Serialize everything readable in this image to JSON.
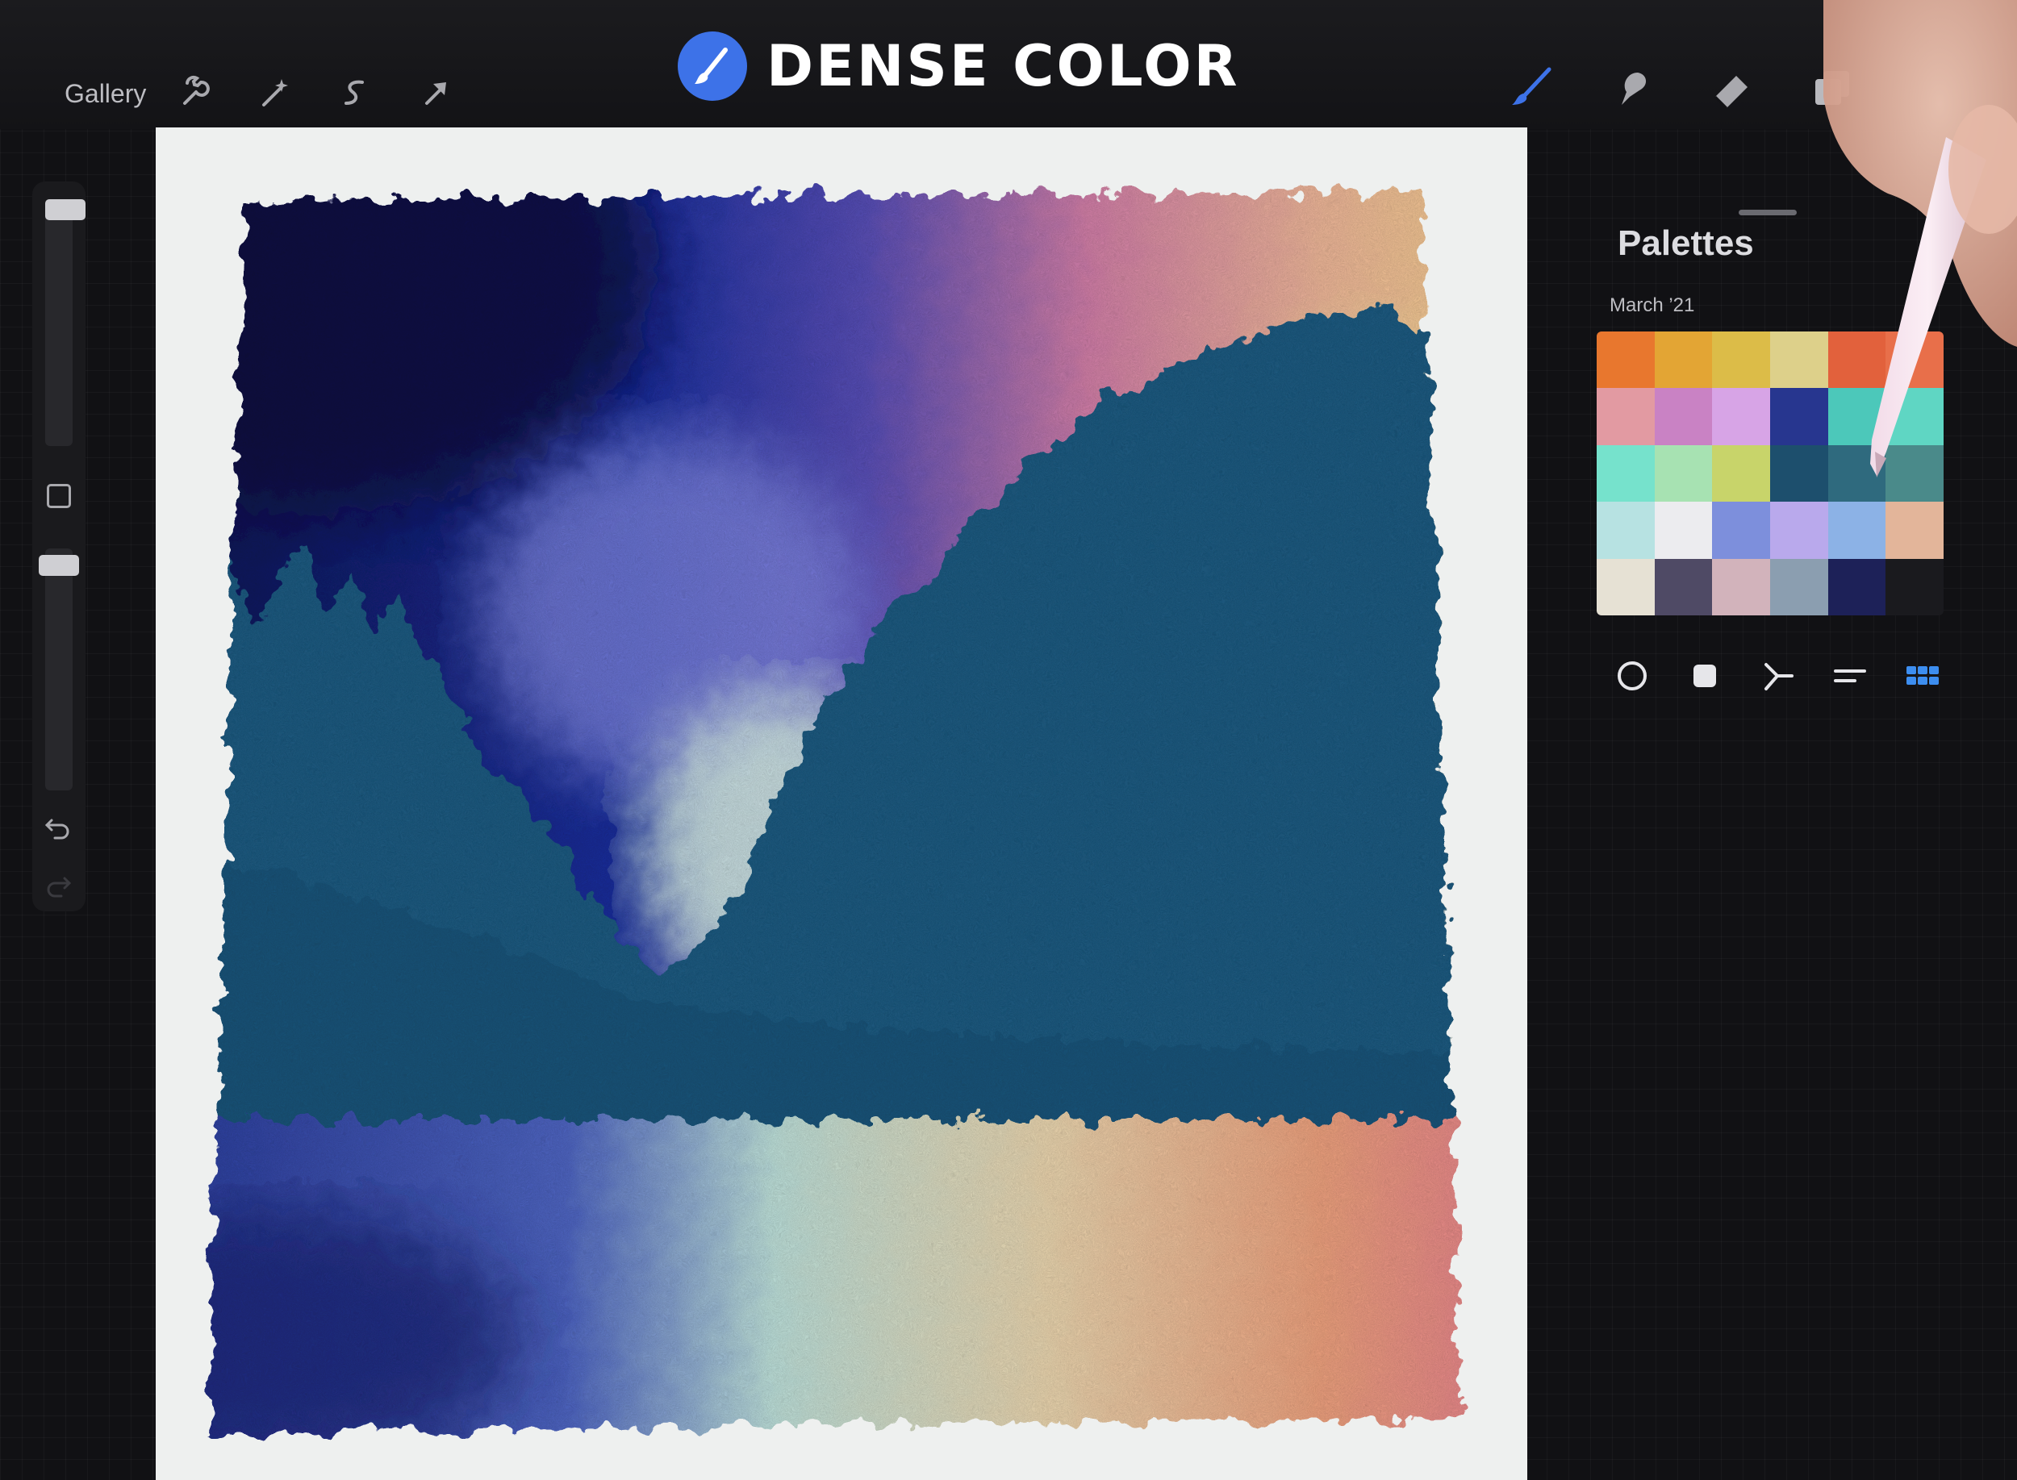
{
  "toolbar": {
    "gallery_label": "Gallery",
    "title": "DENSE COLOR",
    "left_icons": [
      "wrench-icon",
      "magic-wand-icon",
      "selection-icon",
      "move-arrow-icon"
    ],
    "right_icons": [
      "brush-icon",
      "smudge-icon",
      "eraser-icon",
      "layers-icon"
    ],
    "accent_color": "#3d72e8"
  },
  "palette_panel": {
    "title": "Palettes",
    "palette_name": "March ’21",
    "swatches": [
      "#e8772e",
      "#e3a534",
      "#dcbc48",
      "#ddd08a",
      "#e2613c",
      "#e86f4a",
      "#e29aa2",
      "#c982c4",
      "#d7a4e6",
      "#27368f",
      "#4cc8ba",
      "#5fd6c3",
      "#76e2cc",
      "#a7e2b2",
      "#c8d46a",
      "#1d4f6d",
      "#2f6a7e",
      "#4a8a8a",
      "#b7e2e2",
      "#ececef",
      "#7d8fdc",
      "#b9a9ec",
      "#8cb2e6",
      "#e3b59a",
      "#e6e1d4",
      "#4f4a65",
      "#d2b3bb",
      "#8b9eb0",
      "#1d2158",
      "#1a1a1e"
    ],
    "tools": [
      "disc-icon",
      "square-icon",
      "harmony-icon",
      "value-sliders-icon",
      "palette-grid-icon"
    ]
  },
  "sidebar": {
    "icons": [
      "modify-square-icon",
      "undo-icon",
      "redo-icon"
    ]
  }
}
